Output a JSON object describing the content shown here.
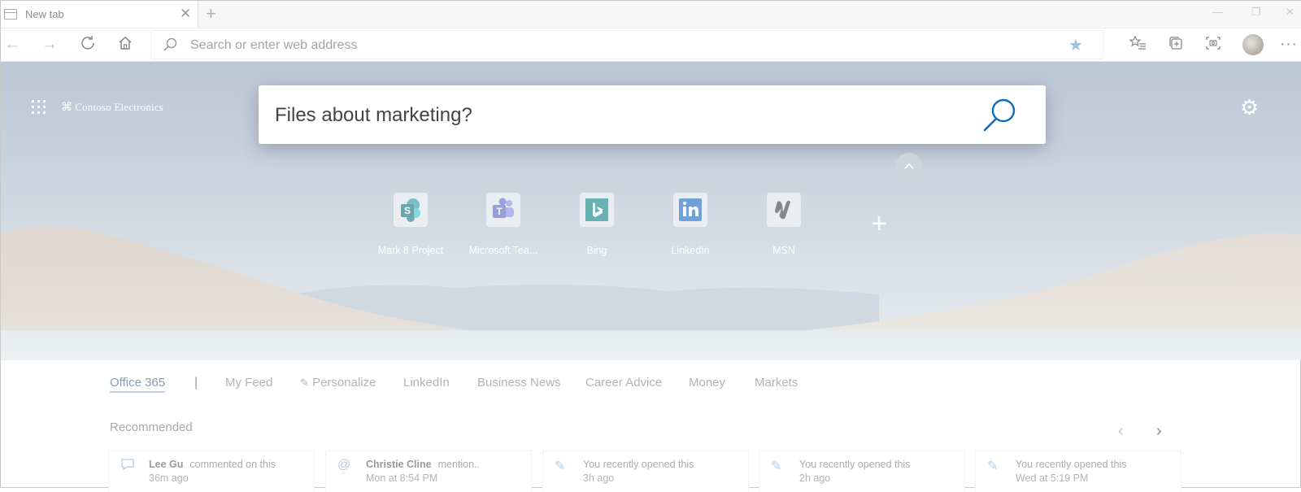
{
  "browser": {
    "tab": {
      "title": "New tab"
    },
    "address_bar": {
      "placeholder": "Search or enter web address"
    }
  },
  "newtab": {
    "brand": "Contoso Electronics",
    "search": {
      "value": "Files about marketing?"
    },
    "quick_links": [
      {
        "label": "Mark 8 Project",
        "icon": "sharepoint-icon",
        "color": "#1f9aa3"
      },
      {
        "label": "Microsoft Tea...",
        "icon": "teams-icon",
        "color": "#6264a7"
      },
      {
        "label": "Bing",
        "icon": "bing-icon",
        "color": "#138a8a"
      },
      {
        "label": "LinkedIn",
        "icon": "linkedin-icon",
        "color": "#0a66c2"
      },
      {
        "label": "MSN",
        "icon": "msn-icon",
        "color": "#333333"
      }
    ],
    "feed_tabs": [
      "Office 365",
      "My Feed",
      "Personalize",
      "LinkedIn",
      "Business News",
      "Career Advice",
      "Money",
      "Markets"
    ],
    "recommended_title": "Recommended",
    "recommended": [
      {
        "name": "Lee Gu",
        "action": "commented on this",
        "time": "36m ago",
        "icon": "comment-icon"
      },
      {
        "name": "Christie Cline",
        "action": "mention..",
        "time": "Mon at 8:54 PM",
        "icon": "mention-icon"
      },
      {
        "name": "",
        "action": "You recently opened this",
        "time": "3h ago",
        "icon": "edit-icon"
      },
      {
        "name": "",
        "action": "You recently opened this",
        "time": "2h ago",
        "icon": "edit-icon"
      },
      {
        "name": "",
        "action": "You recently opened this",
        "time": "Wed at 5:19 PM",
        "icon": "edit-icon"
      }
    ]
  },
  "colors": {
    "accent": "#0f6cbd",
    "favorite_star": "#9ac4e6"
  }
}
